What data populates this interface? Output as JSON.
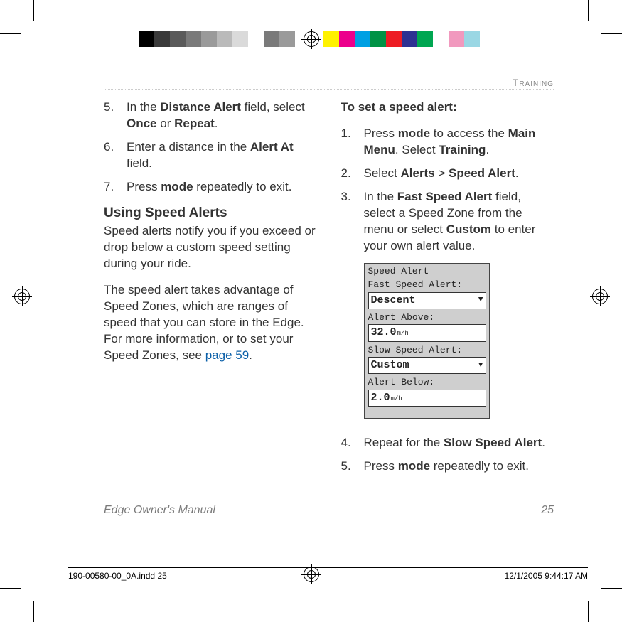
{
  "section_label": "Training",
  "left": {
    "items": [
      {
        "num": "5.",
        "html": "In the <strong>Distance Alert</strong> field, select <strong>Once</strong> or <strong>Repeat</strong>."
      },
      {
        "num": "6.",
        "html": "Enter a distance in the <strong>Alert At</strong> field."
      },
      {
        "num": "7.",
        "html": "Press <strong>mode</strong> repeatedly to exit."
      }
    ],
    "heading": "Using Speed Alerts",
    "para1": "Speed alerts notify you if you exceed or drop below a custom speed setting during your ride.",
    "para2_a": "The speed alert takes advantage of Speed Zones, which are ranges of speed that you can store in the Edge. For more information, or to set your Speed Zones, see ",
    "para2_link": "page 59",
    "para2_b": "."
  },
  "right": {
    "lead": "To set a speed alert:",
    "items": [
      {
        "num": "1.",
        "html": "Press <strong>mode</strong> to access the <strong>Main Menu</strong>. Select <strong>Training</strong>."
      },
      {
        "num": "2.",
        "html": "Select <strong>Alerts</strong> &gt; <strong>Speed Alert</strong>."
      },
      {
        "num": "3.",
        "html": "In the <strong>Fast Speed Alert</strong> field, select a Speed Zone from the menu or select <strong>Custom</strong> to enter your own alert value."
      }
    ],
    "items2": [
      {
        "num": "4.",
        "html": "Repeat for the <strong>Slow Speed Alert</strong>."
      },
      {
        "num": "5.",
        "html": "Press <strong>mode</strong> repeatedly to exit."
      }
    ]
  },
  "device": {
    "title": "Speed Alert",
    "fast_label": "Fast Speed Alert:",
    "fast_value": "Descent",
    "above_label": "Alert Above:",
    "above_value": "32.0",
    "above_unit": "m/h",
    "slow_label": "Slow Speed Alert:",
    "slow_value": "Custom",
    "below_label": "Alert Below:",
    "below_value": "2.0",
    "below_unit": "m/h"
  },
  "footer": {
    "book": "Edge Owner's Manual",
    "page": "25"
  },
  "slug": {
    "file": "190-00580-00_0A.indd   25",
    "stamp": "12/1/2005   9:44:17 AM"
  },
  "colors": {
    "left_bar": [
      "#000",
      "#3a3a3a",
      "#5a5a5a",
      "#7a7a7a",
      "#9a9a9a",
      "#bababa",
      "#dadada",
      "#ffffff",
      "#7a7a7a",
      "#9a9a9a"
    ],
    "right_bar": [
      "#fff200",
      "#ec008c",
      "#00a0e3",
      "#009245",
      "#ed1c24",
      "#2e3192",
      "#00a651",
      "#ffffff",
      "#f199be",
      "#9ad7e4"
    ]
  }
}
